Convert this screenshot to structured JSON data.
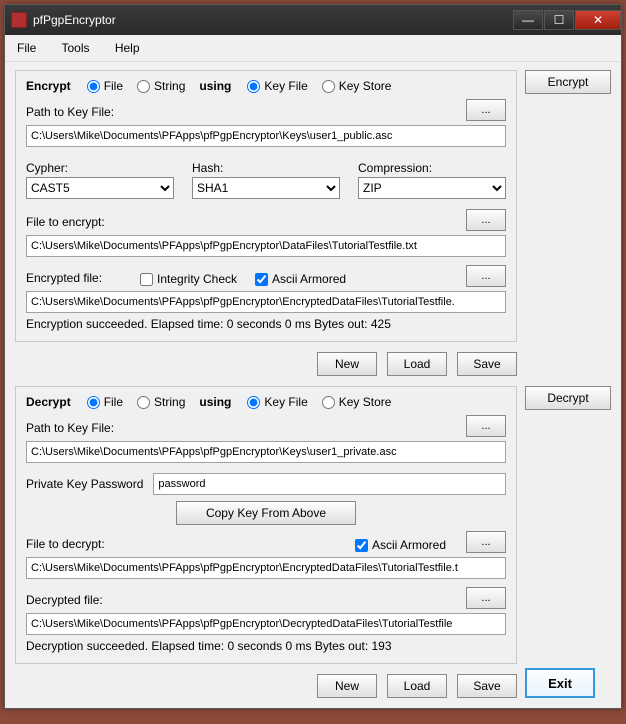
{
  "window": {
    "title": "pfPgpEncryptor"
  },
  "menu": {
    "file": "File",
    "tools": "Tools",
    "help": "Help"
  },
  "common": {
    "using": "using",
    "file_radio": "File",
    "string_radio": "String",
    "keyfile_radio": "Key File",
    "keystore_radio": "Key Store",
    "browse": "...",
    "new": "New",
    "load": "Load",
    "save": "Save",
    "ascii_armored": "Ascii Armored"
  },
  "encrypt": {
    "title": "Encrypt",
    "path_label": "Path to Key File:",
    "path_value": "C:\\Users\\Mike\\Documents\\PFApps\\pfPgpEncryptor\\Keys\\user1_public.asc",
    "cypher_label": "Cypher:",
    "cypher_value": "CAST5",
    "hash_label": "Hash:",
    "hash_value": "SHA1",
    "compression_label": "Compression:",
    "compression_value": "ZIP",
    "file_to_encrypt_label": "File to encrypt:",
    "file_to_encrypt_value": "C:\\Users\\Mike\\Documents\\PFApps\\pfPgpEncryptor\\DataFiles\\TutorialTestfile.txt",
    "encrypted_file_label": "Encrypted file:",
    "integrity_check": "Integrity Check",
    "encrypted_file_value": "C:\\Users\\Mike\\Documents\\PFApps\\pfPgpEncryptor\\EncryptedDataFiles\\TutorialTestfile.",
    "status": "Encryption succeeded. Elapsed time: 0 seconds 0 ms   Bytes out: 425",
    "button": "Encrypt"
  },
  "decrypt": {
    "title": "Decrypt",
    "path_label": "Path to Key File:",
    "path_value": "C:\\Users\\Mike\\Documents\\PFApps\\pfPgpEncryptor\\Keys\\user1_private.asc",
    "password_label": "Private Key Password",
    "password_value": "password",
    "copy_key": "Copy Key From Above",
    "file_to_decrypt_label": "File to decrypt:",
    "file_to_decrypt_value": "C:\\Users\\Mike\\Documents\\PFApps\\pfPgpEncryptor\\EncryptedDataFiles\\TutorialTestfile.t",
    "decrypted_file_label": "Decrypted file:",
    "decrypted_file_value": "C:\\Users\\Mike\\Documents\\PFApps\\pfPgpEncryptor\\DecryptedDataFiles\\TutorialTestfile",
    "status": "Decryption succeeded. Elapsed time: 0 seconds 0 ms   Bytes out: 193",
    "button": "Decrypt"
  },
  "exit": "Exit"
}
